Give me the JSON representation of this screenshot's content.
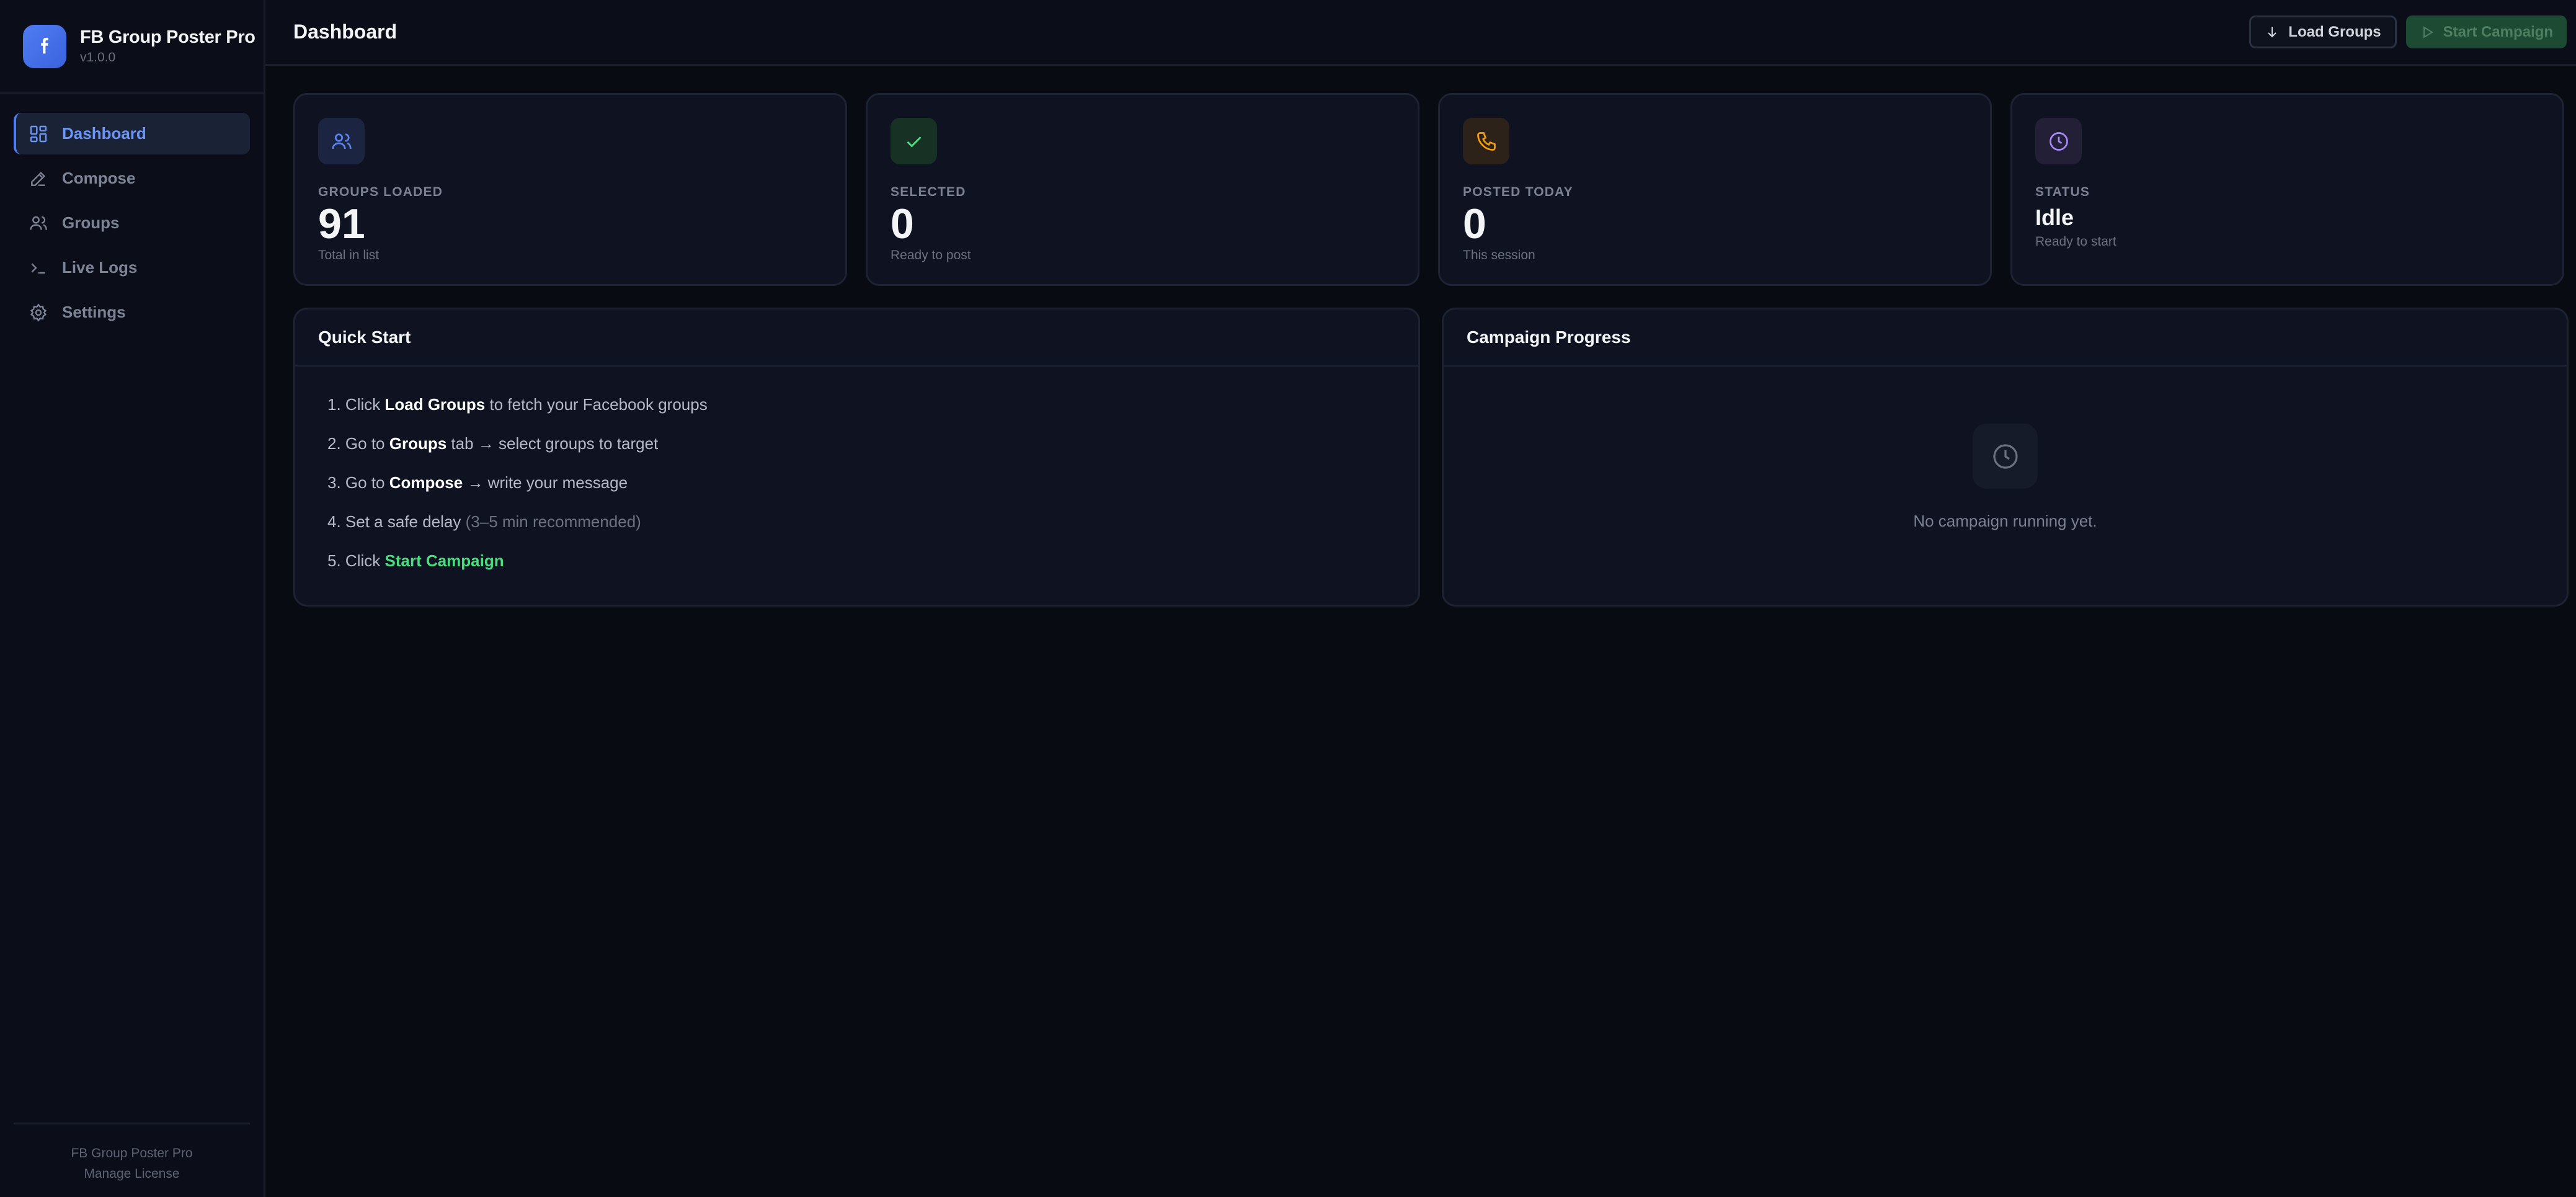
{
  "brand": {
    "name": "FB Group Poster Pro",
    "version": "v1.0.0",
    "logo_icon": "facebook-icon",
    "accent": "#4f7cf3"
  },
  "sidebar": {
    "items": [
      {
        "label": "Dashboard",
        "icon": "grid-icon",
        "active": true
      },
      {
        "label": "Compose",
        "icon": "pencil-icon",
        "active": false
      },
      {
        "label": "Groups",
        "icon": "users-icon",
        "active": false
      },
      {
        "label": "Live Logs",
        "icon": "terminal-icon",
        "active": false
      },
      {
        "label": "Settings",
        "icon": "gear-icon",
        "active": false
      }
    ],
    "footer": {
      "product": "FB Group Poster Pro",
      "license_link": "Manage License"
    }
  },
  "header": {
    "title": "Dashboard",
    "load_groups_label": "Load Groups",
    "start_campaign_label": "Start Campaign"
  },
  "stats": [
    {
      "label": "GROUPS LOADED",
      "value": "91",
      "sub": "Total in list",
      "icon": "users-icon",
      "color": "#5b84f1"
    },
    {
      "label": "SELECTED",
      "value": "0",
      "sub": "Ready to post",
      "icon": "check-icon",
      "color": "#4ade80"
    },
    {
      "label": "POSTED TODAY",
      "value": "0",
      "sub": "This session",
      "icon": "phone-icon",
      "color": "#f59e0b"
    },
    {
      "label": "STATUS",
      "value": "Idle",
      "sub": "Ready to start",
      "icon": "clock-icon",
      "color": "#a78bfa"
    }
  ],
  "quick_start": {
    "title": "Quick Start",
    "steps": [
      {
        "n": "1.",
        "pre": "Click ",
        "bold": "Load Groups",
        "post": " to fetch your Facebook groups"
      },
      {
        "n": "2.",
        "pre": "Go to ",
        "bold": "Groups",
        "post": " tab → select groups to target"
      },
      {
        "n": "3.",
        "pre": "Go to ",
        "bold": "Compose",
        "post": " → write your message"
      },
      {
        "n": "4.",
        "pre": "Set a safe delay ",
        "muted": "(3–5 min recommended)"
      },
      {
        "n": "5.",
        "pre": "Click ",
        "green": "Start Campaign"
      }
    ]
  },
  "campaign": {
    "title": "Campaign Progress",
    "empty_text": "No campaign running yet.",
    "icon": "clock-icon"
  }
}
